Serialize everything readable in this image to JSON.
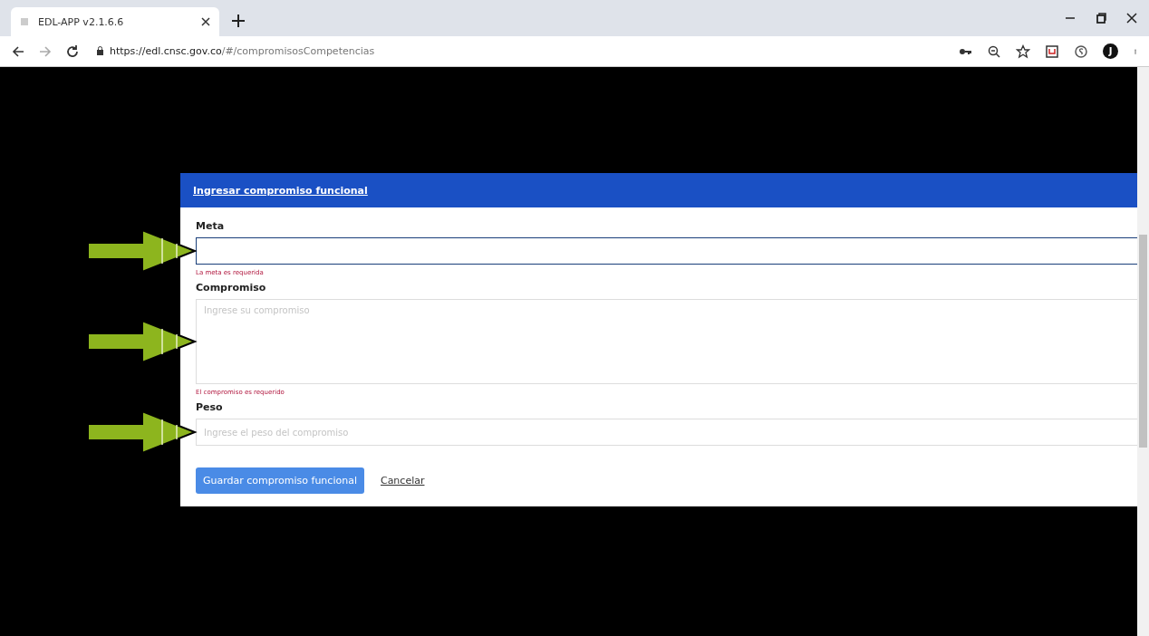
{
  "browser": {
    "tab_title": "EDL-APP v2.1.6.6",
    "url_host": "https://edl.cnsc.gov.co",
    "url_path": "/#/compromisosCompetencias",
    "profile_initial": "J"
  },
  "dialog": {
    "title": "Ingresar compromiso funcional",
    "fields": [
      {
        "kind": "input",
        "label": "Meta",
        "focused": true,
        "error": "La meta es requerida",
        "arrow": true
      },
      {
        "kind": "textarea",
        "label": "Compromiso",
        "placeholder": "Ingrese su compromiso",
        "focused": false,
        "error": "El compromiso es requerido",
        "arrow": true
      },
      {
        "kind": "input",
        "label": "Peso",
        "placeholder": "Ingrese el peso del compromiso",
        "focused": false,
        "arrow": true
      }
    ],
    "save_button": "Guardar compromiso funcional",
    "cancel_link": "Cancelar"
  }
}
